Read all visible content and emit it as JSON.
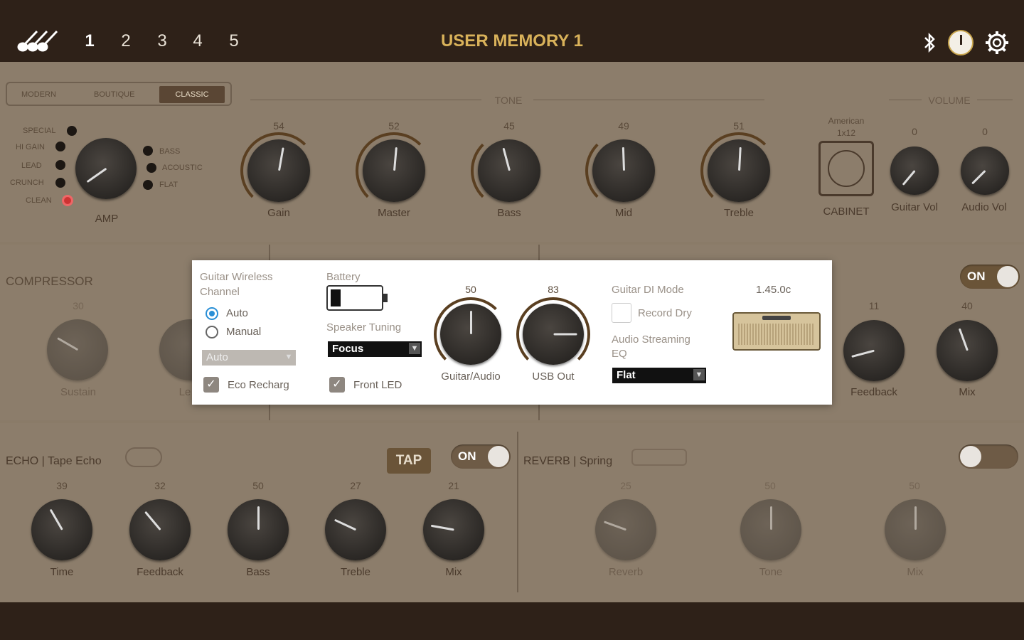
{
  "header": {
    "memories": [
      "1",
      "2",
      "3",
      "4",
      "5"
    ],
    "active_memory": "1",
    "title": "USER MEMORY 1"
  },
  "amp": {
    "tabs": [
      "MODERN",
      "BOUTIQUE",
      "CLASSIC"
    ],
    "active_tab": "CLASSIC",
    "left_types": [
      "SPECIAL",
      "HI GAIN",
      "LEAD",
      "CRUNCH",
      "CLEAN"
    ],
    "right_types": [
      "BASS",
      "ACOUSTIC",
      "FLAT"
    ],
    "selected_type": "CLEAN",
    "label": "AMP"
  },
  "tone": {
    "section_label": "TONE",
    "knobs": [
      {
        "label": "Gain",
        "value": "54"
      },
      {
        "label": "Master",
        "value": "52"
      },
      {
        "label": "Bass",
        "value": "45"
      },
      {
        "label": "Mid",
        "value": "49"
      },
      {
        "label": "Treble",
        "value": "51"
      }
    ]
  },
  "cabinet": {
    "name_line1": "American",
    "name_line2": "1x12",
    "label": "CABINET"
  },
  "volume": {
    "section_label": "VOLUME",
    "knobs": [
      {
        "label": "Guitar Vol",
        "value": "0"
      },
      {
        "label": "Audio Vol",
        "value": "0"
      }
    ]
  },
  "compressor": {
    "title": "COMPRESSOR",
    "knobs": [
      {
        "label": "Sustain",
        "value": "30"
      },
      {
        "label": "Le",
        "value": ""
      }
    ]
  },
  "mod_right": {
    "toggle": "ON",
    "knobs": [
      {
        "label": "Feedback",
        "value": "11"
      },
      {
        "label": "Mix",
        "value": "40"
      }
    ]
  },
  "echo": {
    "title": "ECHO | Tape Echo",
    "tap": "TAP",
    "toggle": "ON",
    "knobs": [
      {
        "label": "Time",
        "value": "39"
      },
      {
        "label": "Feedback",
        "value": "32"
      },
      {
        "label": "Bass",
        "value": "50"
      },
      {
        "label": "Treble",
        "value": "27"
      },
      {
        "label": "Mix",
        "value": "21"
      }
    ]
  },
  "reverb": {
    "title": "REVERB | Spring",
    "knobs": [
      {
        "label": "Reverb",
        "value": "25"
      },
      {
        "label": "Tone",
        "value": "50"
      },
      {
        "label": "Mix",
        "value": "50"
      }
    ]
  },
  "settings": {
    "wireless_label_1": "Guitar Wireless",
    "wireless_label_2": "Channel",
    "radio_auto": "Auto",
    "radio_manual": "Manual",
    "channel_select": "Auto",
    "eco_label": "Eco Recharg",
    "battery_label": "Battery",
    "speaker_label": "Speaker Tuning",
    "speaker_select": "Focus",
    "front_led_label": "Front LED",
    "knob1": {
      "label": "Guitar/Audio",
      "value": "50"
    },
    "knob2": {
      "label": "USB Out",
      "value": "83"
    },
    "di_label": "Guitar DI Mode",
    "record_dry": "Record Dry",
    "streaming_label_1": "Audio Streaming",
    "streaming_label_2": "EQ",
    "eq_select": "Flat",
    "version": "1.45.0c"
  }
}
